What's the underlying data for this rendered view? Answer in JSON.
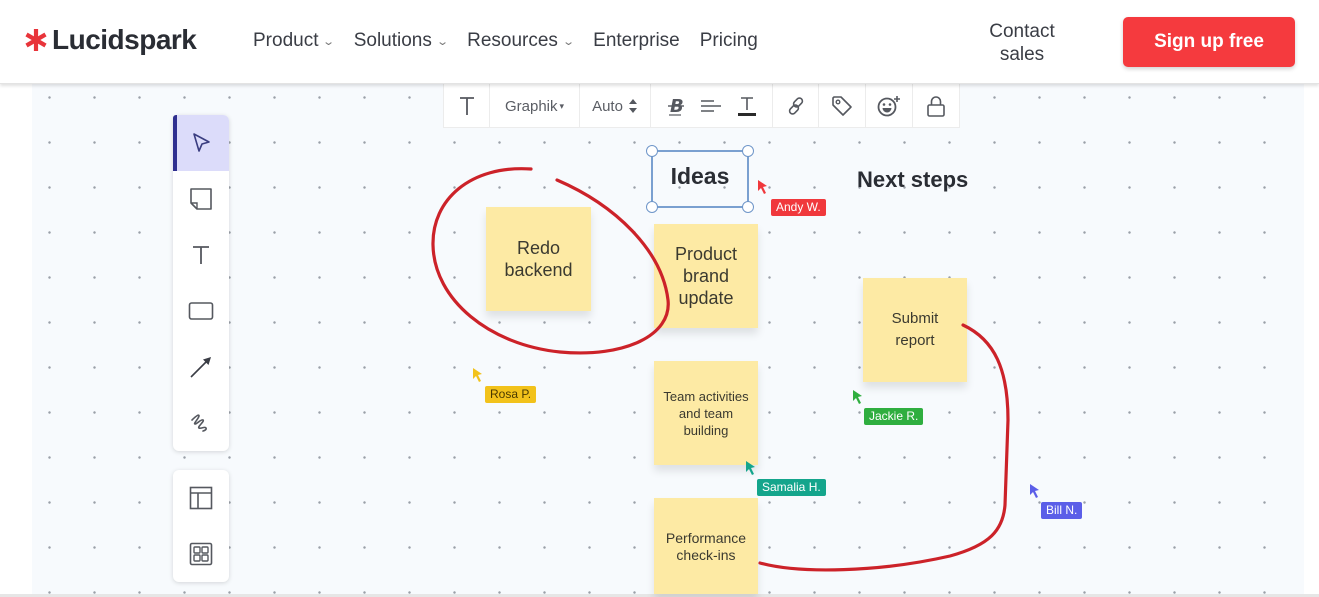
{
  "header": {
    "brand": "Lucidspark",
    "nav": [
      {
        "label": "Product",
        "has_dropdown": true
      },
      {
        "label": "Solutions",
        "has_dropdown": true
      },
      {
        "label": "Resources",
        "has_dropdown": true
      },
      {
        "label": "Enterprise",
        "has_dropdown": false
      },
      {
        "label": "Pricing",
        "has_dropdown": false
      }
    ],
    "contact_line1": "Contact",
    "contact_line2": "sales",
    "signup_label": "Sign up free",
    "accent_color": "#f53a3e"
  },
  "format_toolbar": {
    "text_tool": "text-icon",
    "font": "Graphik",
    "font_caret": "▾",
    "size": "Auto",
    "size_stepper": "⇕",
    "icons": [
      "strikethrough-bold-icon",
      "align-icon",
      "text-color-icon",
      "link-icon",
      "tag-icon",
      "emoji-add-icon",
      "lock-icon"
    ]
  },
  "tool_panel": {
    "tools": [
      {
        "name": "select",
        "icon": "pointer-icon",
        "active": true
      },
      {
        "name": "sticky-note",
        "icon": "sticky-note-icon",
        "active": false
      },
      {
        "name": "text",
        "icon": "text-icon",
        "active": false
      },
      {
        "name": "shape",
        "icon": "rectangle-icon",
        "active": false
      },
      {
        "name": "line",
        "icon": "arrow-icon",
        "active": false
      },
      {
        "name": "draw",
        "icon": "freehand-icon",
        "active": false
      }
    ],
    "extras": [
      {
        "name": "templates",
        "icon": "template-icon"
      },
      {
        "name": "frames",
        "icon": "grid-icon"
      }
    ],
    "active_color": "#2f2f8f"
  },
  "board": {
    "headings": {
      "ideas": "Ideas",
      "next_steps": "Next steps"
    },
    "stickies": [
      {
        "id": "redo",
        "lines": [
          "Redo",
          "backend"
        ]
      },
      {
        "id": "product",
        "lines": [
          "Product",
          "brand",
          "update"
        ]
      },
      {
        "id": "team",
        "lines": [
          "Team activities",
          "and team",
          "building"
        ]
      },
      {
        "id": "perf",
        "lines": [
          "Performance",
          "check-ins"
        ]
      },
      {
        "id": "submit",
        "lines": [
          "Submit",
          "report"
        ]
      }
    ],
    "sticky_color": "#fdeaa4",
    "ink_color": "#cc2229",
    "collaborators": [
      {
        "name": "Andy W.",
        "color": "#f0383c"
      },
      {
        "name": "Rosa P.",
        "color": "#f2c21b",
        "text_color": "#4a3a00"
      },
      {
        "name": "Jackie R.",
        "color": "#2fae3f"
      },
      {
        "name": "Samalia H.",
        "color": "#14a58c"
      },
      {
        "name": "Bill N.",
        "color": "#5b5ee8"
      }
    ]
  }
}
